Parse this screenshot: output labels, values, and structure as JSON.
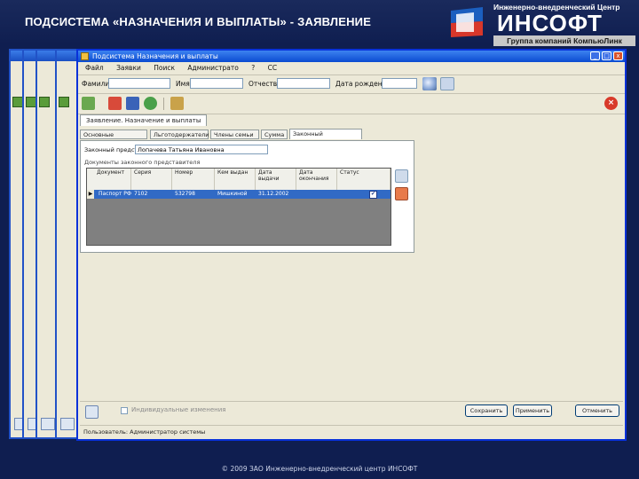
{
  "slide": {
    "title": "ПОДСИСТЕМА «НАЗНАЧЕНИЯ И ВЫПЛАТЫ» - ЗАЯВЛЕНИЕ",
    "logo": {
      "tagline": "Инженерно-внедренческий Центр",
      "name": "ИНСОФТ",
      "group": "Группа компаний КомпьюЛинк"
    },
    "copyright": "© 2009 ЗАО Инженерно-внедренческий центр ИНСОФТ"
  },
  "window": {
    "title": "Подсистема Назначения и выплаты",
    "buttons": [
      "_",
      "□",
      "x"
    ]
  },
  "menu": {
    "items": [
      "Файл",
      "Заявки",
      "Поиск",
      "Администрато",
      "?",
      "СС"
    ]
  },
  "search": {
    "labels": [
      "Фамилия",
      "Имя",
      "Отчество",
      "Дата рождения"
    ]
  },
  "document_tab": {
    "label": "Заявление. Назначение и выплаты"
  },
  "inner_tabs": [
    {
      "label": "Основные сведения"
    },
    {
      "label": "Льготодержатели"
    },
    {
      "label": "Члены семьи"
    },
    {
      "label": "Сумма"
    },
    {
      "label": "Законный представитель"
    }
  ],
  "panel": {
    "representative_label": "Законный предст.",
    "representative_value": "Лопачева Татьяна Ивановна",
    "documents_caption": "Документы законного представителя",
    "grid": {
      "headers": [
        "Документ",
        "Серия",
        "Номер",
        "Кем выдан",
        "Дата выдачи",
        "Дата окончания",
        "Статус"
      ],
      "row": {
        "selector": "▶",
        "cells": [
          "Паспорт РФ",
          "7102",
          "532798",
          "Мишкиной",
          "31.12.2002",
          ""
        ],
        "checked": true,
        "check_mark": "✔"
      }
    }
  },
  "footer": {
    "checkbox_label": "Индивидуальные изменения",
    "buttons": [
      "Сохранить",
      "Применить",
      "Отменить"
    ]
  },
  "statusbar": {
    "text": "Пользователь: Администратор системы"
  },
  "colors": {
    "slide_background": "#0f1e50",
    "window_titlebar": "#0a4bd1",
    "selection": "#316ac5"
  }
}
